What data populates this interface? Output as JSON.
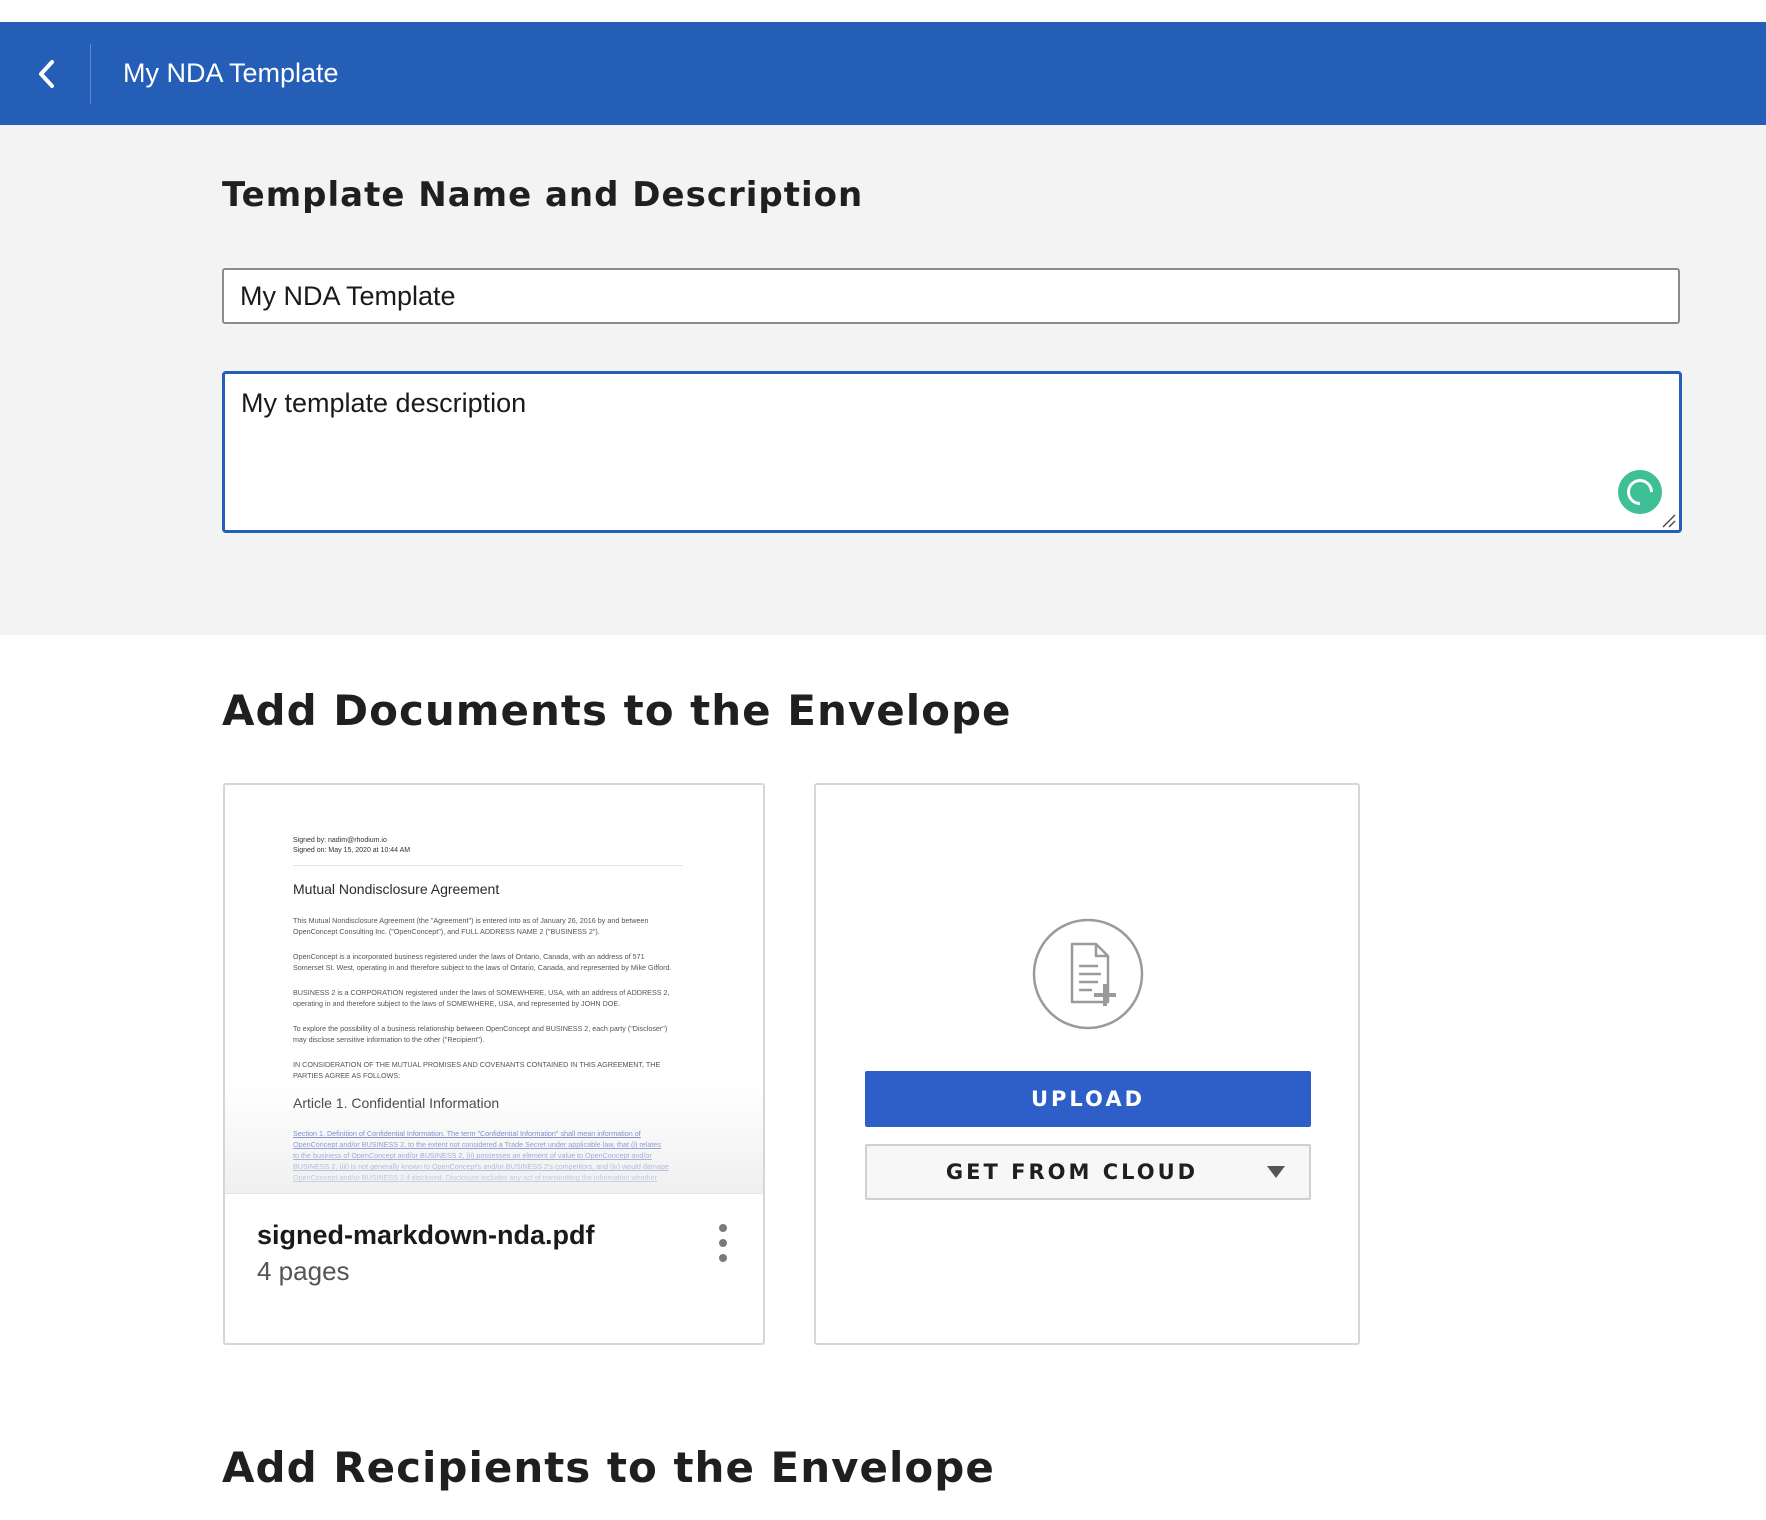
{
  "header": {
    "title": "My NDA Template",
    "back_icon": "chevron-left-icon"
  },
  "template_section": {
    "heading": "Template Name and Description",
    "name_value": "My NDA Template",
    "description_value": "My template description"
  },
  "documents_section": {
    "heading": "Add Documents to the Envelope",
    "documents": [
      {
        "file_name": "signed-markdown-nda.pdf",
        "pages": "4 pages",
        "preview": {
          "signed_by": "Signed by: nadim@rhodium.io",
          "signed_on": "Signed on: May 15, 2020 at 10:44 AM",
          "title": "Mutual Nondisclosure Agreement",
          "paragraphs": [
            "This Mutual Nondisclosure Agreement (the \"Agreement\") is entered into as of January 26, 2016 by and between",
            "OpenConcept Consulting Inc. (\"OpenConcept\"), and FULL ADDRESS NAME 2 (\"BUSINESS 2\").",
            "OpenConcept is a incorporated business registered under the laws of Ontario, Canada, with an address of 571",
            "Somerset St. West, operating in and therefore subject to the laws of Ontario, Canada, and represented by Mike Gifford.",
            "BUSINESS 2 is a CORPORATION registered under the laws of SOMEWHERE, USA, with an address of ADDRESS 2,",
            "operating in and therefore subject to the laws of SOMEWHERE, USA, and represented by JOHN DOE.",
            "To explore the possibility of a business relationship between OpenConcept and BUSINESS 2, each party (\"Discloser\")",
            "may disclose sensitive information to the other (\"Recipient\").",
            "IN CONSIDERATION OF THE MUTUAL PROMISES AND COVENANTS CONTAINED IN THIS AGREEMENT, THE",
            "PARTIES AGREE AS FOLLOWS:"
          ],
          "article_title": "Article 1. Confidential Information",
          "article_lines": [
            "Section 1. Definition of Confidential Information. The term \"Confidential Information\" shall mean information of",
            "OpenConcept and/or BUSINESS 2, to the extent not considered a Trade Secret under applicable law, that (i) relates",
            "to the business of OpenConcept and/or BUSINESS 2, (ii) possesses an element of value to OpenConcept and/or",
            "BUSINESS 2, (iii) is not generally known to OpenConcept's and/or BUSINESS 2's competitors, and (iv) would damage",
            "OpenConcept and/or BUSINESS 2 if disclosed. Disclosure includes any act of transmitting the information whether"
          ]
        }
      }
    ],
    "upload": {
      "icon": "file-add-icon",
      "upload_label": "UPLOAD",
      "cloud_label": "GET FROM CLOUD",
      "cloud_caret_icon": "caret-down-icon"
    }
  },
  "recipients_section": {
    "heading": "Add Recipients to the Envelope"
  },
  "colors": {
    "header_bg": "#245eb6",
    "primary_button": "#2e5fc9",
    "section_bg": "#f3f3f3",
    "grammarly": "#3fbf95"
  }
}
